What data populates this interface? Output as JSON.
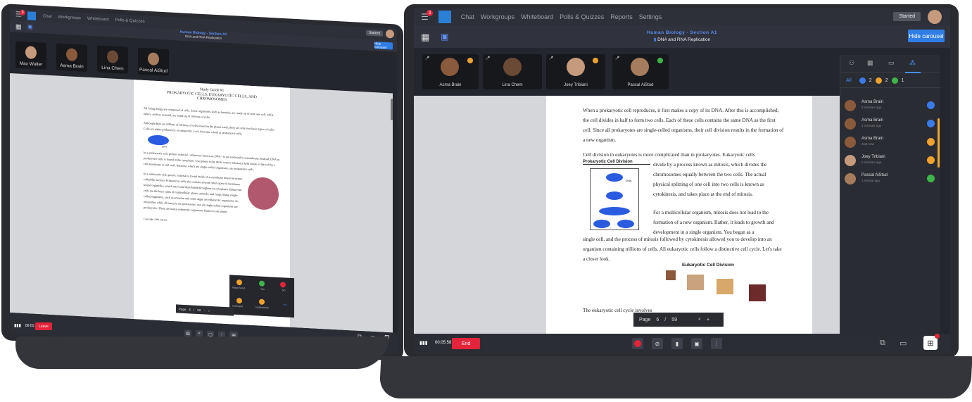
{
  "left_app": {
    "nav": [
      "Chat",
      "Workgroups",
      "Whiteboard",
      "Polls & Quizzes"
    ],
    "notif_count": "3",
    "started_label": "Started",
    "course_title": "Human Biology - Section A1",
    "doc_title": "DNA and RNA Replication",
    "hide_carousel": "Hide carousel",
    "participants": [
      "Max Walter",
      "Asma Brain",
      "Lina Chem",
      "Pascal AiStud"
    ],
    "doc": {
      "heading_1": "Study Guide #1",
      "heading_2": "PROKARYOTIC CELLS, EUKARYOTIC CELLS, AND",
      "heading_3": "CHROMOSOMES",
      "para_1": "All living things are composed of cells. Some organisms, such as bacteria, are made up of only one cell, while others, such as yourself, are made up of trillions of cells.",
      "para_2": "Although there are billions of trillions of cells found on the planet earth, there are only two basic types of cells. Cells are either prokaryotic or eukaryotic. Let's first take a look at prokaryotic cells.",
      "para_3": "In a prokaryotic cell, genetic material - otherwise known as DNA - is not enclosed in a membrane. Instead, DNA in prokaryotic cells is found in the cytoplasm. Cytoplasm is the thick, watery substance held inside of the cell by a cell membrane or cell wall. Bacteria, which are single-celled organisms, are prokaryotic cells.",
      "para_4": "In a eukaryotic cell, genetic material is found inside of a membrane bound structure called the nucleus. Prokaryotic cells also contain several other types of membrane bound organelles, which are found distributed throughout its cytoplasm. Eukaryotic cells are the basic units of multicellular plants, animals, and fungi. Many single-celled organisms, such as amoebas and some algae are eukaryotic organisms. So remember, while all bacteria are prokaryotic, not all single-celled organisms are prokaryotic. There are many eukaryotic organisms found on our planet.",
      "dna_label": "DNA",
      "copyright": "Copyright 1998 LifeSci"
    },
    "reactions": [
      "Raise hand",
      "Yes",
      "No",
      "Confused",
      "I understand"
    ],
    "page_label": "Page",
    "page_current": "5",
    "page_total": "59",
    "timer": "00:01:00",
    "leave_label": "Leave"
  },
  "right_app": {
    "nav": [
      "Chat",
      "Workgroups",
      "Whiteboard",
      "Polls & Quizzes",
      "Reports",
      "Settings"
    ],
    "notif_count": "3",
    "started_label": "Started",
    "course_title": "Human Biology - Section A1",
    "doc_title": "DNA and RNA Replication",
    "hide_carousel": "Hide carousel",
    "participants": [
      "Asma Brain",
      "Lina Chem",
      "Joey Tribiani",
      "Pascal AiStud"
    ],
    "doc": {
      "para_1": "When a prokaryotic cell reproduces, it first makes a copy of its DNA. After this is accomplished, the cell divides in half to form two cells. Each of these cells contains the same DNA as the first cell. Since all prokaryotes are single-celled organisms, their cell division results in the formation of a new organism.",
      "para_2a": "Cell division in eukaryotes is more complicated than in prokaryotes. Eukaryotic cells",
      "para_2b": "divide by a process known as mitosis, which divides the chromosomes equally between the two cells. The actual physical splitting of one cell into two cells is known as cytokinesis, and takes place at the end of mitosis.",
      "para_3a": "For a multicellular organism, mitosis does not lead to the formation of a new organism. Rather, it leads to growth and development in a single organism. You began as a",
      "para_3b": "single cell, and the process of mitosis followed by cytokinesis allowed you to develop into an organism containing trillions of cells. All eukaryotic cells follow a distinctive cell cycle. Let's take a closer look.",
      "fig_1_title": "Prokaryotic Cell Division",
      "fig_1_dna": "DNA",
      "fig_2_title": "Eukaryotic Cell Division",
      "para_4": "The eukaryotic cell cycle involves"
    },
    "page_label": "Page",
    "page_current": "6",
    "page_total": "59",
    "timer": "00:05:58",
    "end_label": "End",
    "side_panel": {
      "filter_all": "All",
      "count_hands": "2",
      "count_confused": "2",
      "count_yes": "1",
      "people": [
        {
          "name": "Asma Brain",
          "time": "2 minutes ago",
          "status": "hand"
        },
        {
          "name": "Asma Brain",
          "time": "2 minutes ago",
          "status": "hand"
        },
        {
          "name": "Asma Brain",
          "time": "Just now",
          "status": "confused"
        },
        {
          "name": "Joey Tribiani",
          "time": "2 minutes ago",
          "status": "confused"
        },
        {
          "name": "Pascal AiStud",
          "time": "1 minute ago",
          "status": "yes"
        }
      ]
    }
  },
  "colors": {
    "accent_blue": "#2f7ee6",
    "end_red": "#e4243b",
    "hand_blue": "#3b7be8",
    "confused_orange": "#f0a22e",
    "yes_green": "#3fb549"
  }
}
